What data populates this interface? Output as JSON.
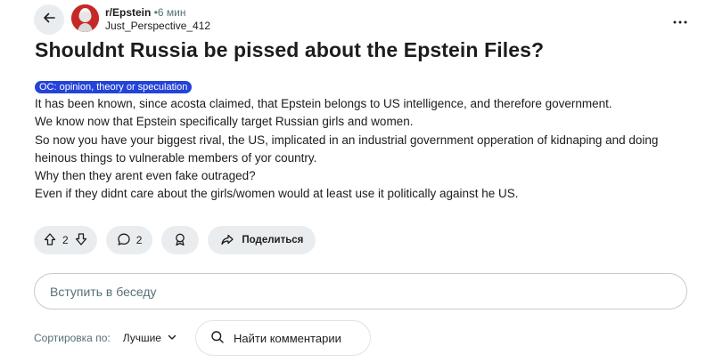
{
  "post": {
    "subreddit": "r/Epstein",
    "separator": "•",
    "time": "6 мин",
    "author": "Just_Perspective_412",
    "title": "Shouldnt Russia be pissed about the Epstein Files?",
    "flair": "OC: opinion, theory or speculation",
    "body": [
      "It has been known, since acosta claimed, that Epstein belongs to US intelligence, and therefore government.",
      "We know now that Epstein specifically target Russian girls and women.",
      "So now you have your biggest rival, the US, implicated in an industrial government opperation of kidnaping and doing heinous things to vulnerable members of yor country.",
      "Why then they arent even fake outraged?",
      "Even if they didnt care about the girls/women would at least use it politically against he US."
    ]
  },
  "actions": {
    "vote_count": "2",
    "comment_count": "2",
    "share_label": "Поделиться"
  },
  "comment_box": {
    "placeholder": "Вступить в беседу"
  },
  "sort": {
    "label": "Сортировка по:",
    "value": "Лучшие"
  },
  "search_comments": {
    "placeholder": "Найти комментарии"
  },
  "icons": {
    "back": "arrow-left-icon",
    "more": "more-horizontal-icon",
    "upvote": "upvote-arrow-icon",
    "downvote": "downvote-arrow-icon",
    "comment": "comment-bubble-icon",
    "award": "award-icon",
    "share": "share-arrow-icon",
    "chevron": "chevron-down-icon",
    "search": "search-icon"
  },
  "colors": {
    "flair_bg": "#2443d9",
    "pill_bg": "#eaedef",
    "muted_text": "#576f76"
  }
}
